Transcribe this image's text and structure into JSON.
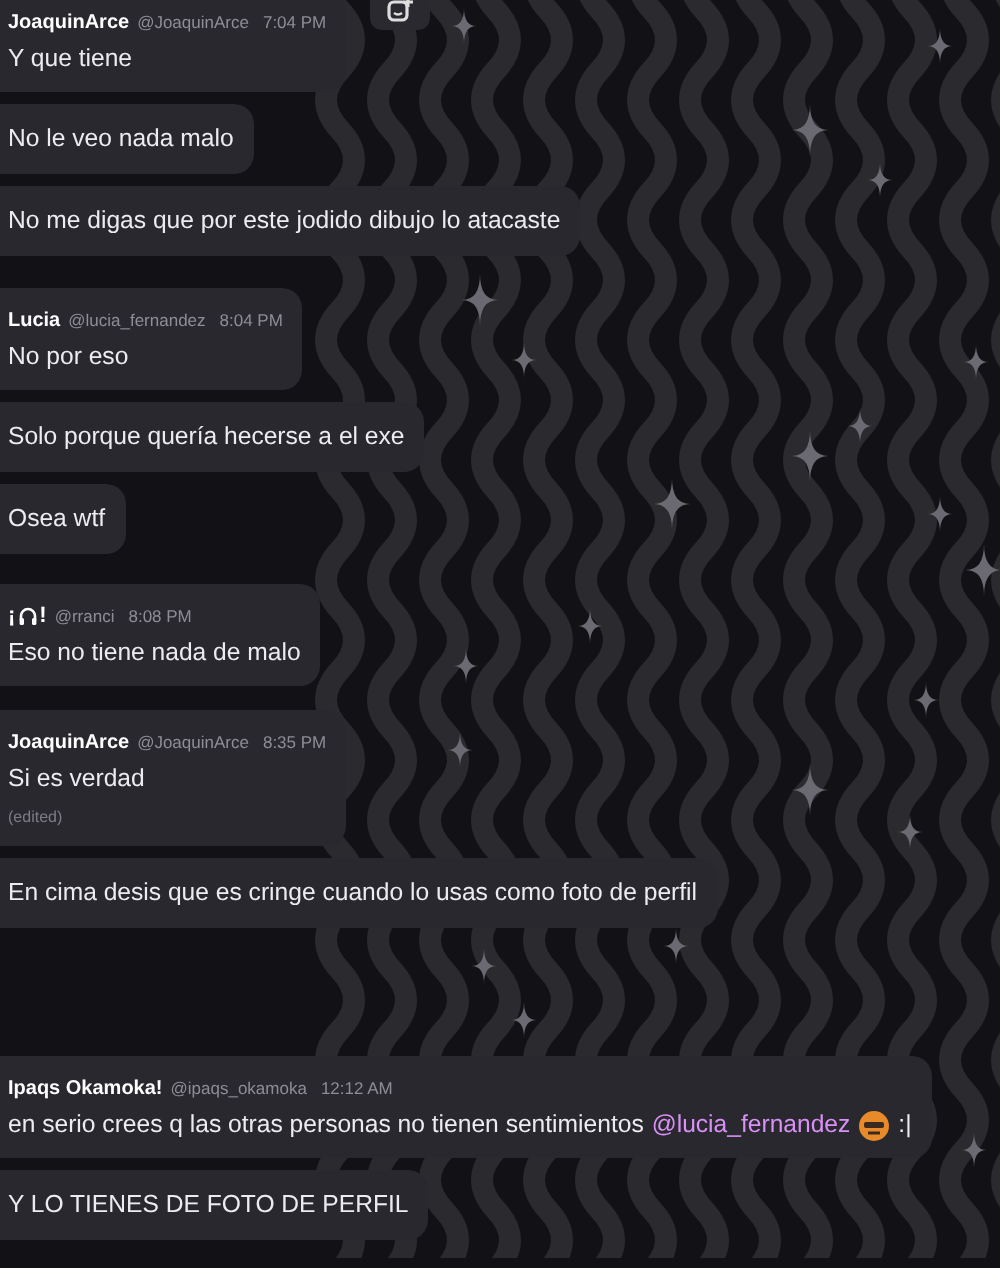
{
  "groups": [
    {
      "author": "JoaquinArce",
      "handle": "@JoaquinArce",
      "time": "7:04 PM",
      "messages": [
        {
          "text": "Y que tiene"
        },
        {
          "text": "No le veo nada malo"
        },
        {
          "text": "No me digas que por este jodido dibujo lo atacaste"
        }
      ]
    },
    {
      "author": "Lucia",
      "handle": "@lucia_fernandez",
      "time": "8:04 PM",
      "messages": [
        {
          "text": "No por eso"
        },
        {
          "text": "Solo porque quería hecerse a el exe"
        },
        {
          "text": "Osea wtf"
        }
      ]
    },
    {
      "author_prefix": "¡",
      "author_suffix": "!",
      "handle": "@rranci",
      "time": "8:08 PM",
      "messages": [
        {
          "text": "Eso no tiene nada de malo"
        }
      ]
    },
    {
      "author": "JoaquinArce",
      "handle": "@JoaquinArce",
      "time": "8:35 PM",
      "messages": [
        {
          "text": "Si es verdad",
          "edited": "(edited)"
        },
        {
          "text": "En cima desis que es cringe cuando lo usas como foto de perfil"
        }
      ]
    },
    {
      "author": "Ipaqs Okamoka!",
      "handle": "@ipaqs_okamoka",
      "time": "12:12 AM",
      "messages": [
        {
          "text": "en serio crees q las otras personas no tienen sentimientos",
          "mention": "@lucia_fernandez",
          "tail": ":|"
        },
        {
          "text": "Y LO TIENES DE FOTO DE PERFIL"
        }
      ]
    }
  ]
}
